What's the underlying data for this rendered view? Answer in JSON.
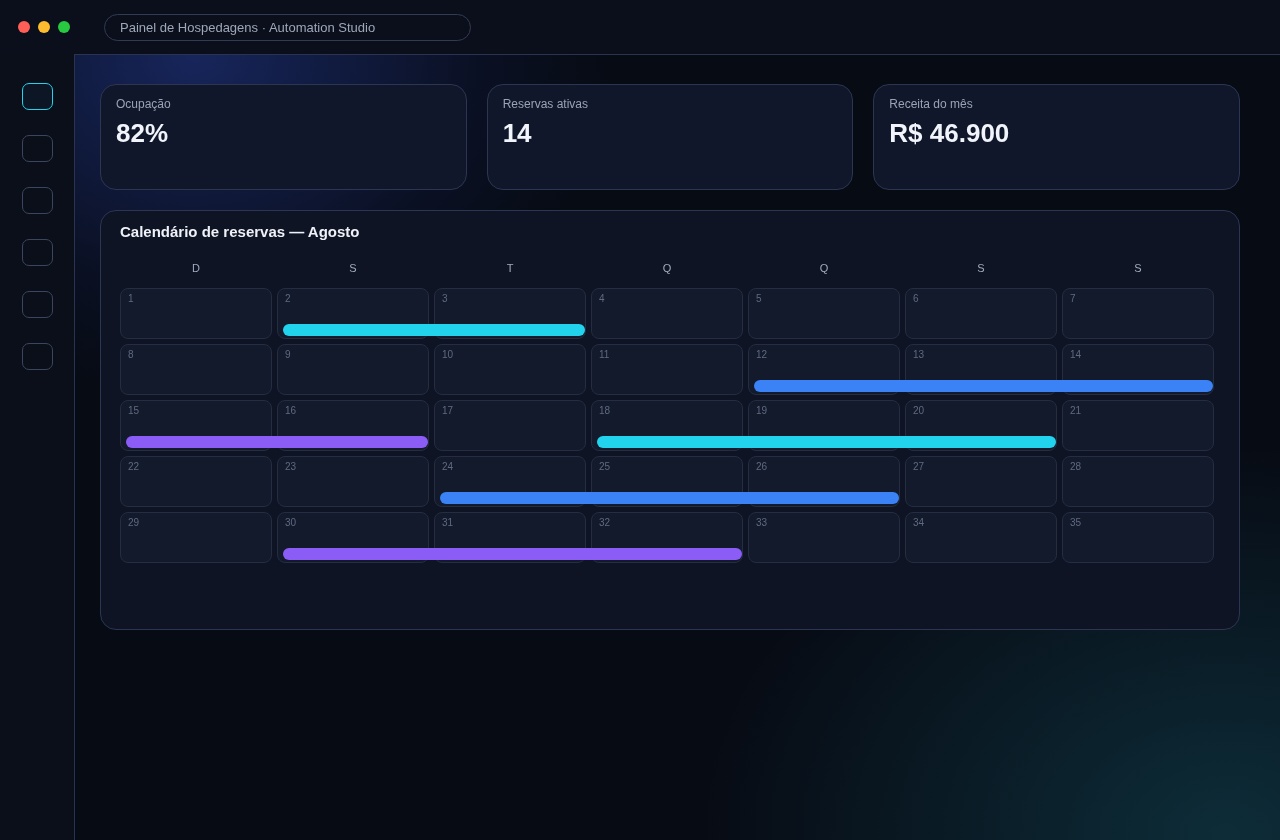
{
  "window": {
    "title": "Painel de Hospedagens · Automation Studio"
  },
  "sidebar": {
    "items": [
      {
        "selected": true
      },
      {
        "selected": false
      },
      {
        "selected": false
      },
      {
        "selected": false
      },
      {
        "selected": false
      },
      {
        "selected": false
      }
    ]
  },
  "stats": [
    {
      "label": "Ocupação",
      "value": "82%"
    },
    {
      "label": "Reservas ativas",
      "value": "14"
    },
    {
      "label": "Receita do mês",
      "value": "R$ 46.900"
    }
  ],
  "calendar": {
    "title": "Calendário de reservas — Agosto",
    "weekdays": [
      "D",
      "S",
      "T",
      "Q",
      "Q",
      "S",
      "S"
    ],
    "weeks": [
      {
        "days": [
          {
            "label": "1"
          },
          {
            "label": "2",
            "color": "#22d3ee"
          },
          {
            "label": "3",
            "color": "#22d3ee"
          },
          {
            "label": "4"
          },
          {
            "label": "5"
          },
          {
            "label": "6"
          },
          {
            "label": "7"
          }
        ]
      },
      {
        "days": [
          {
            "label": "8"
          },
          {
            "label": "9"
          },
          {
            "label": "10"
          },
          {
            "label": "11"
          },
          {
            "label": "12",
            "color": "#3b82f6"
          },
          {
            "label": "13",
            "color": "#3b82f6"
          },
          {
            "label": "14",
            "color": "#3b82f6"
          }
        ]
      },
      {
        "days": [
          {
            "label": "15",
            "color": "#8b5cf6"
          },
          {
            "label": "16",
            "color": "#8b5cf6"
          },
          {
            "label": "17"
          },
          {
            "label": "18",
            "color": "#22d3ee"
          },
          {
            "label": "19",
            "color": "#22d3ee"
          },
          {
            "label": "20",
            "color": "#22d3ee"
          },
          {
            "label": "21"
          }
        ]
      },
      {
        "days": [
          {
            "label": "22"
          },
          {
            "label": "23"
          },
          {
            "label": "24",
            "color": "#3b82f6"
          },
          {
            "label": "25",
            "color": "#3b82f6"
          },
          {
            "label": "26",
            "color": "#3b82f6"
          },
          {
            "label": "27"
          },
          {
            "label": "28"
          }
        ]
      },
      {
        "days": [
          {
            "label": "29"
          },
          {
            "label": "30",
            "color": "#8b5cf6"
          },
          {
            "label": "31",
            "color": "#8b5cf6"
          },
          {
            "label": "32",
            "color": "#8b5cf6"
          },
          {
            "label": "33"
          },
          {
            "label": "34"
          },
          {
            "label": "35"
          }
        ]
      }
    ]
  }
}
